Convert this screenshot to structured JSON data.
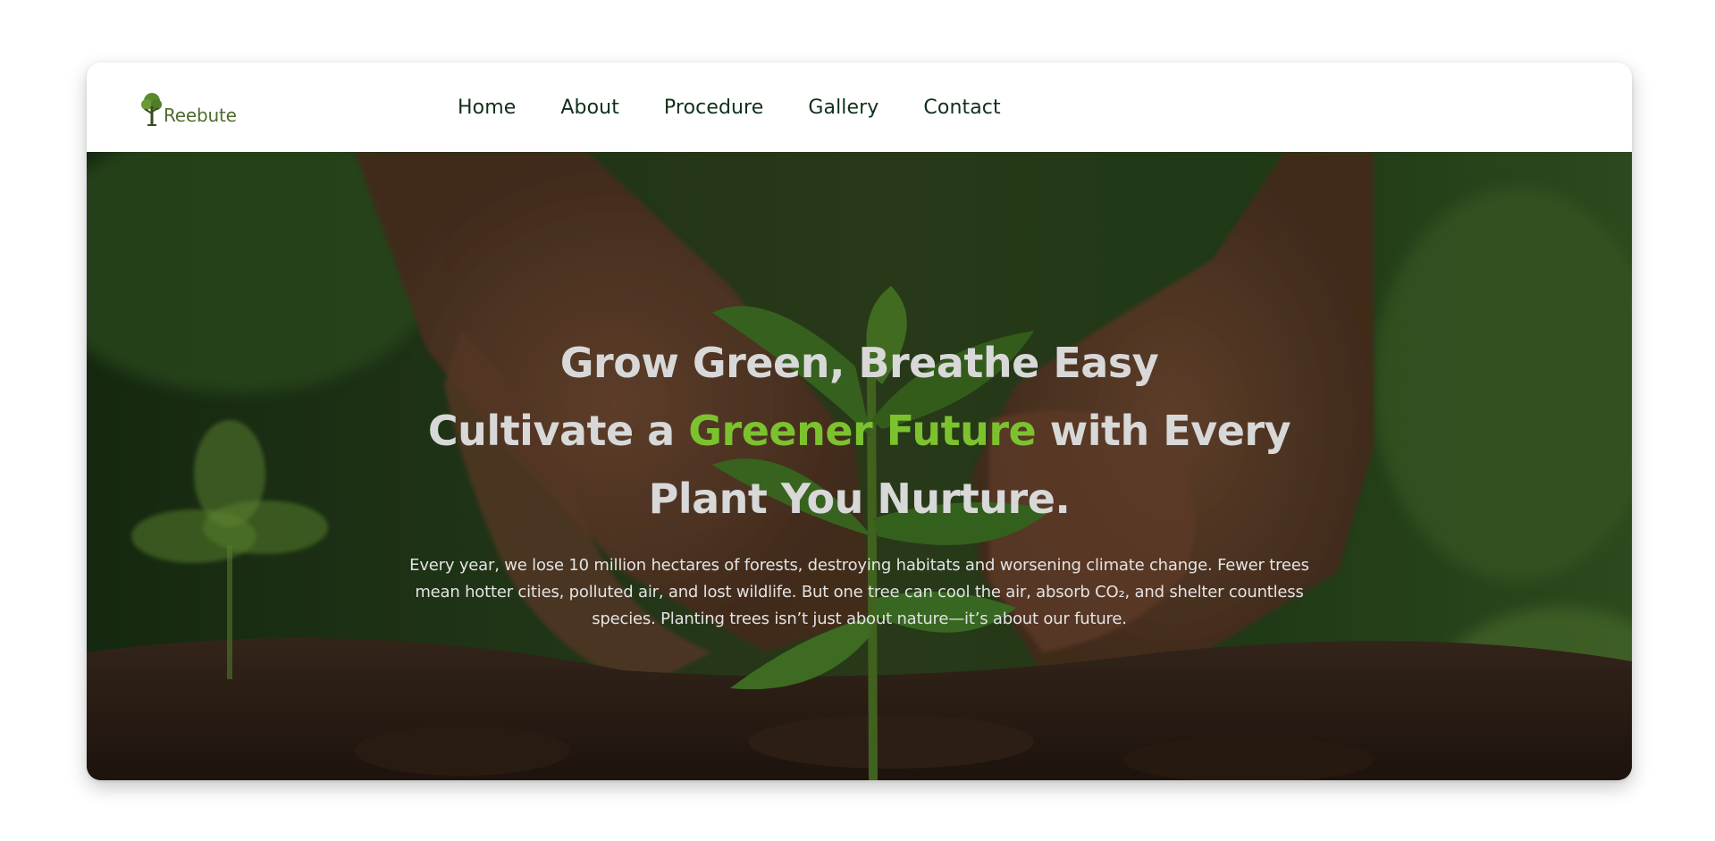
{
  "brand": {
    "name": "Reebute",
    "logo_icon": "tree-icon",
    "color": "#4f6b30"
  },
  "nav": {
    "items": [
      {
        "label": "Home"
      },
      {
        "label": "About"
      },
      {
        "label": "Procedure"
      },
      {
        "label": "Gallery"
      },
      {
        "label": "Contact"
      }
    ],
    "color": "#10301a"
  },
  "hero": {
    "headline_line1": "Grow Green, Breathe Easy",
    "headline_pre": "Cultivate a",
    "headline_accent": "Greener Future",
    "headline_post": "with Every Plant You Nurture.",
    "accent_color": "#7cc22f",
    "description": "Every year, we lose 10 million hectares of forests, destroying habitats and worsening climate change. Fewer trees mean hotter cities, polluted air, and lost wildlife. But one tree can cool the air, absorb CO₂, and shelter countless species. Planting trees isn’t just about nature—it’s about our future.",
    "background_image": "hands-planting-seedling-in-soil"
  }
}
